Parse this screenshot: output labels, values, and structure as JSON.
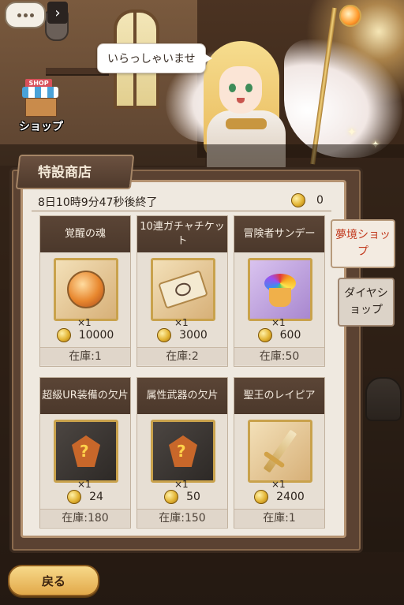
{
  "greeting": "いらっしゃいませ",
  "shop_label": "ショップ",
  "shop_sign": "SHOP",
  "title": "特設商店",
  "timer": "8日10時9分47秒後終了",
  "wallet": {
    "icon": "coin-icon",
    "value": "0"
  },
  "tabs": [
    {
      "label": "夢境ショップ",
      "active": true
    },
    {
      "label": "ダイヤショップ",
      "active": false
    }
  ],
  "items": [
    {
      "name": "覚醒の魂",
      "qty": "×1",
      "price": "10000",
      "stock": "在庫:1",
      "icon": "soul-icon"
    },
    {
      "name": "10連ガチャチケット",
      "qty": "×1",
      "price": "3000",
      "stock": "在庫:2",
      "icon": "ticket-icon"
    },
    {
      "name": "冒険者サンデー",
      "qty": "×1",
      "price": "600",
      "stock": "在庫:50",
      "icon": "sundae-icon"
    },
    {
      "name": "超級UR装備の欠片",
      "qty": "×1",
      "price": "24",
      "stock": "在庫:180",
      "icon": "armor-fragment-icon"
    },
    {
      "name": "属性武器の欠片",
      "qty": "×1",
      "price": "50",
      "stock": "在庫:150",
      "icon": "weapon-fragment-icon"
    },
    {
      "name": "聖王のレイピア",
      "qty": "×1",
      "price": "2400",
      "stock": "在庫:1",
      "icon": "rapier-icon"
    }
  ],
  "back_button": "戻る",
  "colors": {
    "accent_tab": "#c23a1e",
    "panel": "#5b4232",
    "coin": "#e3b434"
  }
}
